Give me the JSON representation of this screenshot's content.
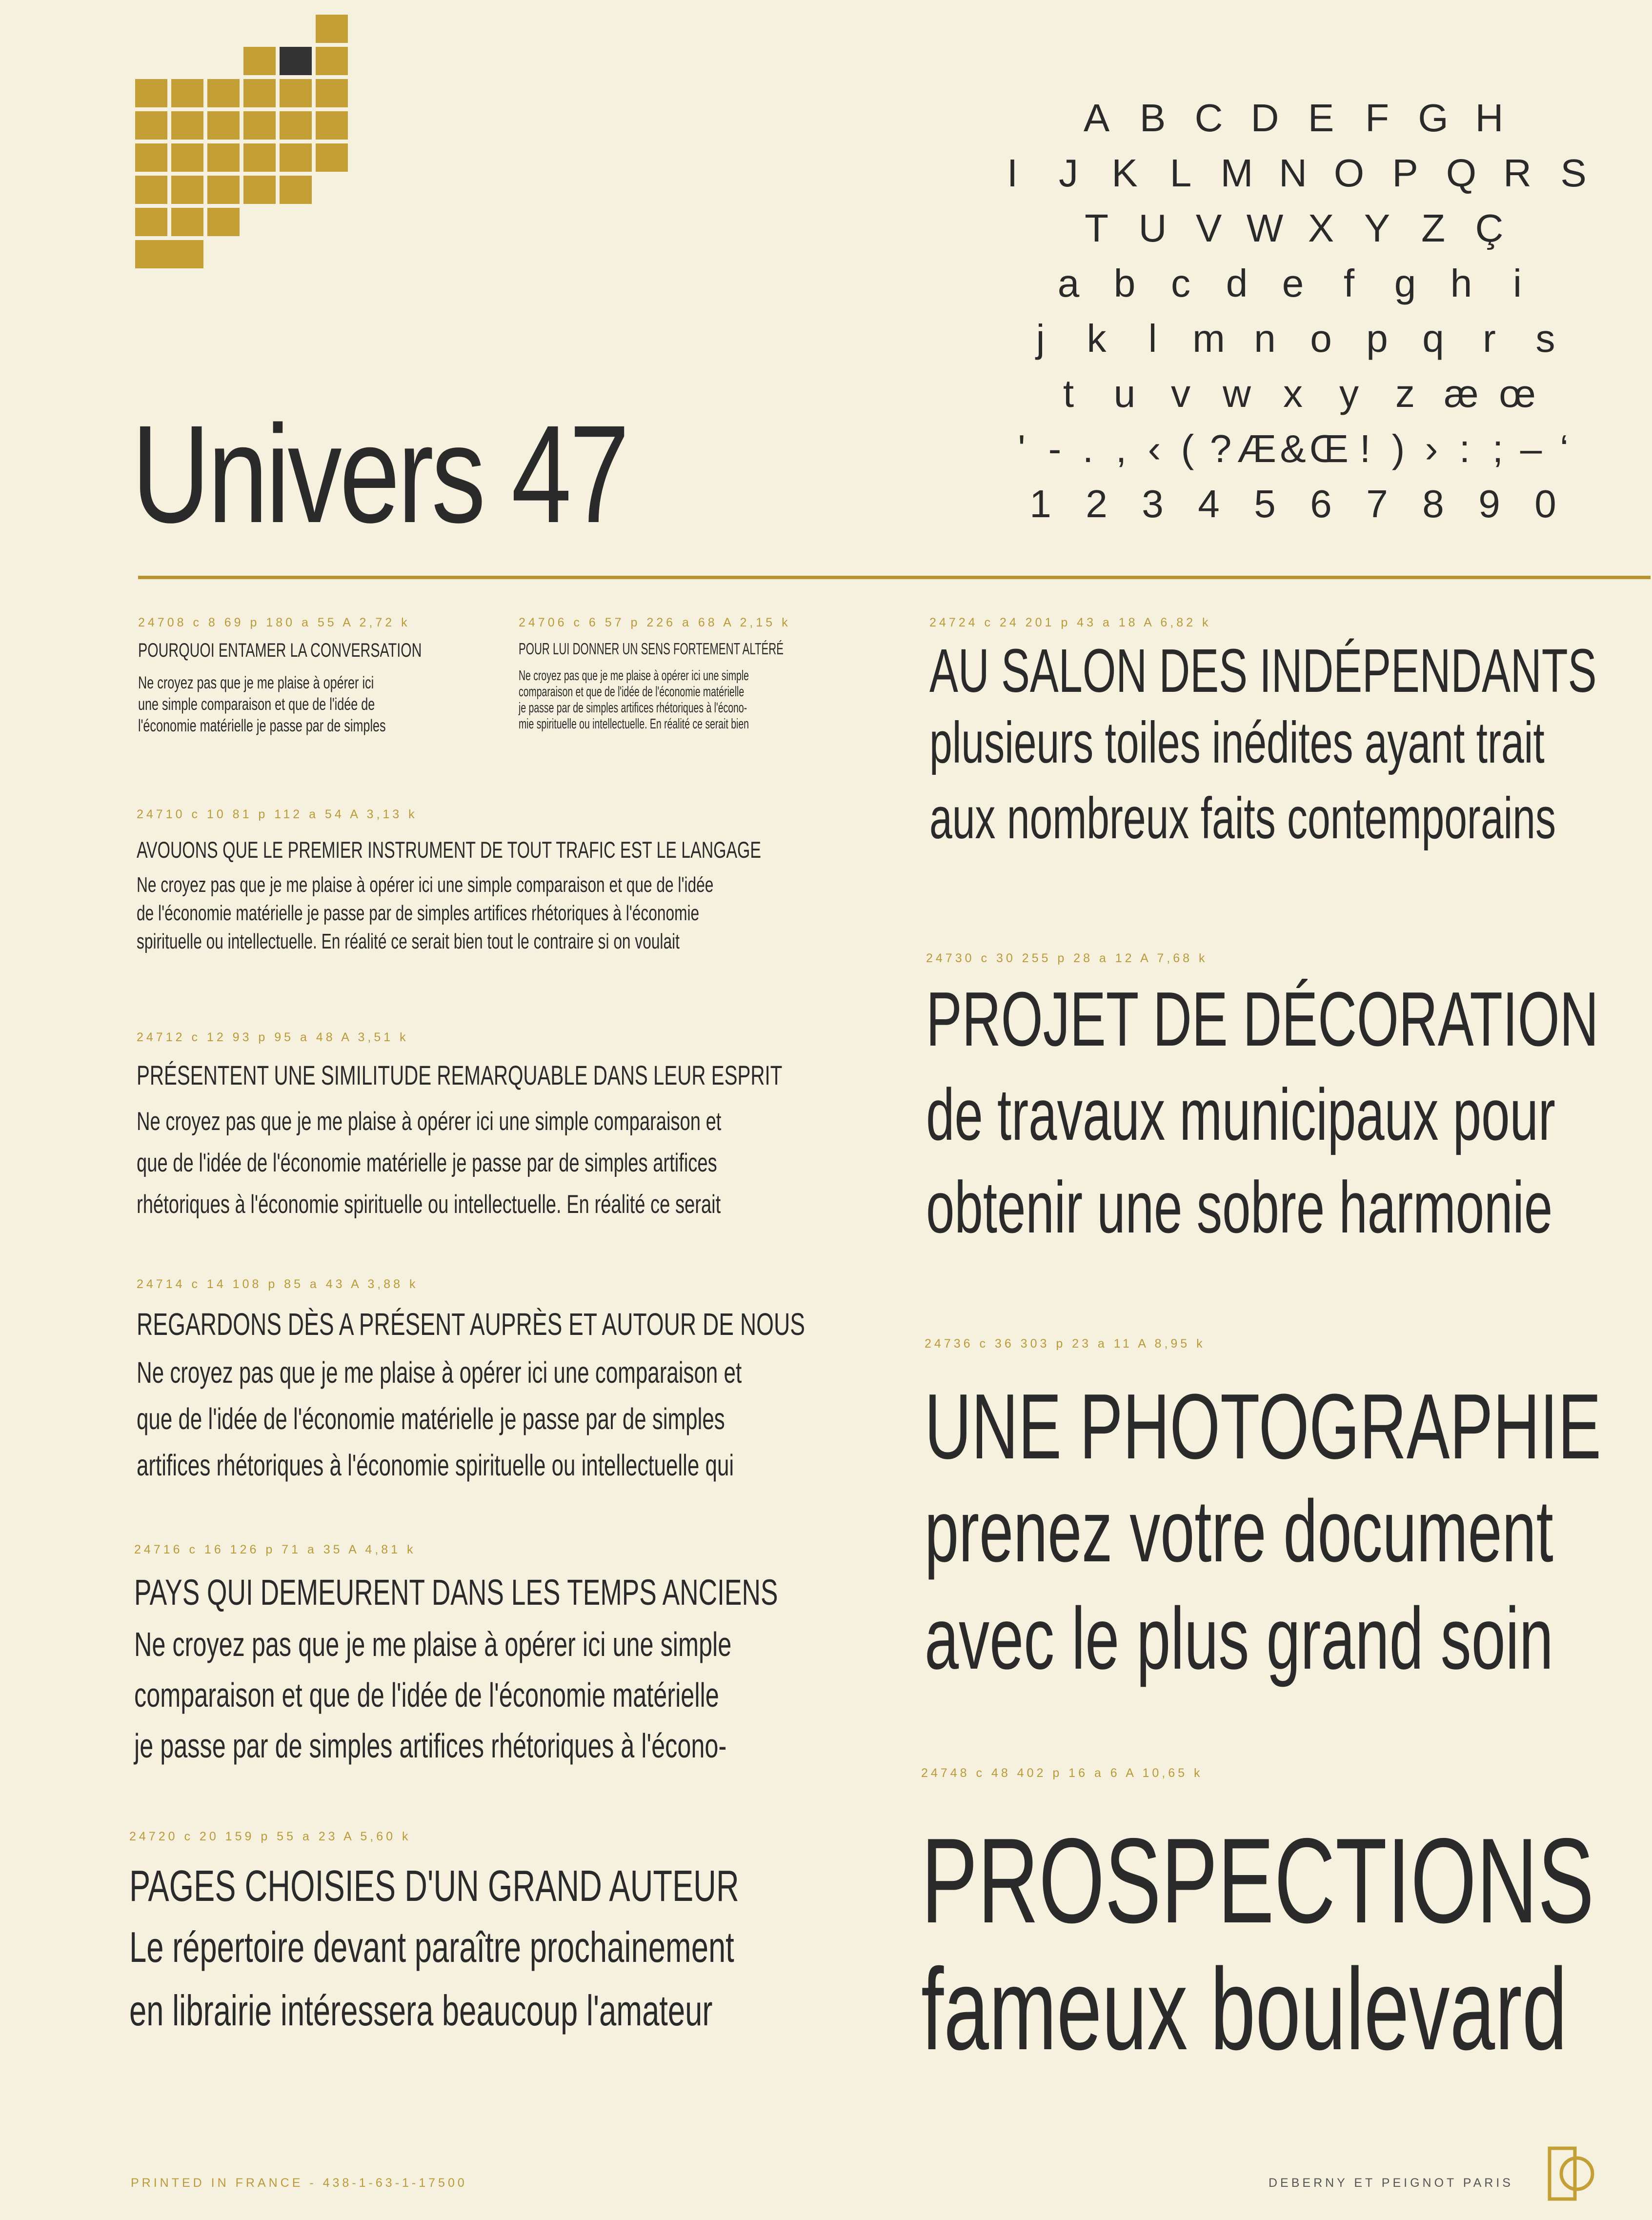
{
  "title": "Univers 47",
  "charset": [
    [
      "A",
      "B",
      "C",
      "D",
      "E",
      "F",
      "G",
      "H"
    ],
    [
      "I",
      "J",
      "K",
      "L",
      "M",
      "N",
      "O",
      "P",
      "Q",
      "R",
      "S"
    ],
    [
      "T",
      "U",
      "V",
      "W",
      "X",
      "Y",
      "Z",
      "Ç"
    ],
    [
      "a",
      "b",
      "c",
      "d",
      "e",
      "f",
      "g",
      "h",
      "i"
    ],
    [
      "j",
      "k",
      "l",
      "m",
      "n",
      "o",
      "p",
      "q",
      "r",
      "s"
    ],
    [
      "t",
      "u",
      "v",
      "w",
      "x",
      "y",
      "z",
      "æ",
      "œ"
    ],
    [
      "'",
      "-",
      ".",
      ",",
      "‹",
      "(",
      "?",
      "Æ",
      "&",
      "Œ",
      "!",
      ")",
      "›",
      ":",
      ";",
      "–",
      "‘"
    ],
    [
      "1",
      "2",
      "3",
      "4",
      "5",
      "6",
      "7",
      "8",
      "9",
      "0"
    ]
  ],
  "left": [
    {
      "meta": "24708  c 8  69 p  180 a 55 A  2,72 k",
      "head": "POURQUOI ENTAMER LA CONVERSATION",
      "lines": [
        "Ne croyez pas que je me plaise à opérer ici",
        "une simple comparaison et que de l'idée de",
        "l'économie matérielle je passe par de simples"
      ]
    },
    {
      "meta": "24706  c 6  57 p  226 a 68 A  2,15 k",
      "head": "POUR LUI DONNER UN SENS FORTEMENT ALTÉRÉ",
      "lines": [
        "Ne croyez pas que je me plaise à opérer ici une simple",
        "comparaison et que de l'idée de l'économie matérielle",
        "je passe par de simples artifices rhétoriques à l'écono-",
        "mie spirituelle ou intellectuelle. En réalité ce serait bien"
      ]
    },
    {
      "meta": "24710  c 10  81 p  112 a 54 A  3,13 k",
      "head": "AVOUONS QUE LE PREMIER INSTRUMENT DE TOUT TRAFIC EST LE LANGAGE",
      "lines": [
        "Ne croyez pas que je me plaise à opérer ici une simple comparaison et que de l'idée",
        "de l'économie matérielle je passe par de simples artifices rhétoriques à l'économie",
        "spirituelle ou intellectuelle. En réalité ce serait bien tout le contraire si on voulait"
      ]
    },
    {
      "meta": "24712  c 12  93 p  95 a 48 A  3,51 k",
      "head": "PRÉSENTENT UNE SIMILITUDE REMARQUABLE DANS LEUR ESPRIT",
      "lines": [
        "Ne croyez pas que je me plaise à opérer ici une simple comparaison et",
        "que de l'idée de l'économie matérielle je passe par de simples artifices",
        "rhétoriques à l'économie spirituelle ou intellectuelle. En réalité ce serait"
      ]
    },
    {
      "meta": "24714  c 14  108 p  85 a 43 A  3,88 k",
      "head": "REGARDONS DÈS A PRÉSENT AUPRÈS ET AUTOUR DE NOUS",
      "lines": [
        "Ne croyez pas que je me plaise à opérer ici une comparaison et",
        "que de l'idée de l'économie matérielle je passe par de simples",
        "artifices rhétoriques à l'économie spirituelle ou intellectuelle qui"
      ]
    },
    {
      "meta": "24716  c 16  126 p  71 a 35 A  4,81 k",
      "head": "PAYS QUI DEMEURENT DANS LES TEMPS ANCIENS",
      "lines": [
        "Ne croyez pas que je me plaise à opérer ici une simple",
        "comparaison et que de l'idée de l'économie matérielle",
        "je passe par de simples artifices rhétoriques à l'écono-"
      ]
    },
    {
      "meta": "24720  c 20  159 p  55 a 23 A  5,60 k",
      "head": "PAGES CHOISIES D'UN GRAND AUTEUR",
      "lines": [
        "Le répertoire devant paraître prochainement",
        "en librairie intéressera beaucoup l'amateur"
      ]
    }
  ],
  "right": [
    {
      "meta": "24724  c 24  201 p  43 a 18 A  6,82 k",
      "head": "AU SALON DES INDÉPENDANTS",
      "lines": [
        "plusieurs toiles inédites ayant trait",
        "aux nombreux faits contemporains"
      ]
    },
    {
      "meta": "24730  c 30  255 p  28 a 12 A  7,68 k",
      "head": "PROJET DE DÉCORATION",
      "lines": [
        "de travaux municipaux pour",
        "obtenir une sobre harmonie"
      ]
    },
    {
      "meta": "24736  c 36  303 p  23 a 11 A  8,95 k",
      "head": "UNE PHOTOGRAPHIE",
      "lines": [
        "prenez votre document",
        "avec le plus grand soin"
      ]
    },
    {
      "meta": "24748  c 48  402 p  16 a 6 A  10,65 k",
      "head": "PROSPECTIONS",
      "lines": [
        "fameux boulevard"
      ]
    }
  ],
  "footer": {
    "left": "PRINTED IN FRANCE - 438-1-63-1-17500",
    "right": "DEBERNY ET PEIGNOT PARIS"
  },
  "colors": {
    "gold": "#c39f35",
    "ink": "#2a2a2a",
    "paper": "#f6f1df"
  }
}
